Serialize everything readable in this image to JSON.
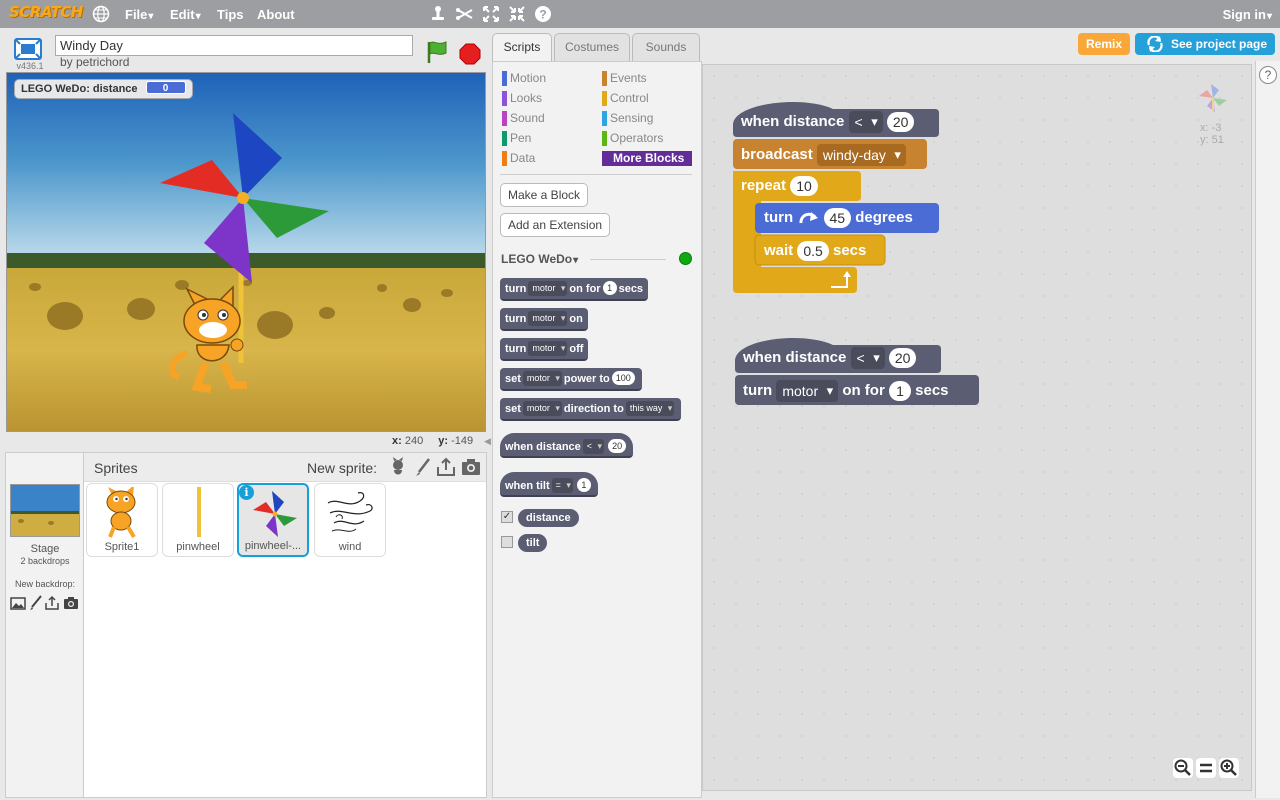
{
  "topbar": {
    "logo": "SCRATCH",
    "menus": {
      "file": "File",
      "edit": "Edit",
      "tips": "Tips",
      "about": "About"
    },
    "signin": "Sign in"
  },
  "project": {
    "title": "Windy Day",
    "byline": "by petrichord",
    "version": "v436.1"
  },
  "stage": {
    "monitor_label": "LEGO WeDo: distance",
    "monitor_value": "0",
    "coords_x_label": "x:",
    "coords_x": "240",
    "coords_y_label": "y:",
    "coords_y": "-149"
  },
  "sprites_pane": {
    "title": "Sprites",
    "new_sprite": "New sprite:",
    "stage_name": "Stage",
    "stage_backdrops": "2 backdrops",
    "new_backdrop": "New backdrop:",
    "sprites": [
      "Sprite1",
      "pinwheel",
      "pinwheel-...",
      "wind"
    ]
  },
  "tabs": {
    "scripts": "Scripts",
    "costumes": "Costumes",
    "sounds": "Sounds"
  },
  "palette": {
    "categories": [
      {
        "label": "Motion",
        "color": "#4a6cd4"
      },
      {
        "label": "Looks",
        "color": "#8a55d7"
      },
      {
        "label": "Sound",
        "color": "#bb42c3"
      },
      {
        "label": "Pen",
        "color": "#0e9a6c"
      },
      {
        "label": "Data",
        "color": "#ee7d16"
      },
      {
        "label": "Events",
        "color": "#c88330"
      },
      {
        "label": "Control",
        "color": "#e1a91a"
      },
      {
        "label": "Sensing",
        "color": "#2ca5e2"
      },
      {
        "label": "Operators",
        "color": "#5cb712"
      },
      {
        "label": "More Blocks",
        "color": "#632d99"
      }
    ],
    "make_block": "Make a Block",
    "add_extension": "Add an Extension",
    "extension_name": "LEGO WeDo",
    "blocks": {
      "turn": "turn",
      "motor": "motor",
      "on_for": "on for",
      "one": "1",
      "secs": "secs",
      "on": "on",
      "off": "off",
      "set": "set",
      "power_to": "power to",
      "hundred": "100",
      "direction_to": "direction to",
      "this_way": "this way",
      "when_distance": "when distance",
      "lt": "<",
      "twenty": "20",
      "when_tilt": "when tilt",
      "eq": "=",
      "distance": "distance",
      "tilt": "tilt"
    }
  },
  "buttons": {
    "remix": "Remix",
    "see_project": "See project page"
  },
  "scripts": {
    "script1": {
      "hat": "when distance",
      "op": "<",
      "value": "20",
      "broadcast": "broadcast",
      "message": "windy-day",
      "repeat": "repeat",
      "repeat_count": "10",
      "turn": "turn",
      "degrees_value": "45",
      "degrees": "degrees",
      "wait": "wait",
      "wait_value": "0.5",
      "secs": "secs"
    },
    "script2": {
      "hat": "when distance",
      "op": "<",
      "value": "20",
      "turn": "turn",
      "motor": "motor",
      "on_for": "on for",
      "secs_value": "1",
      "secs": "secs"
    },
    "sprite_x": "x: -3",
    "sprite_y": "y: 51"
  },
  "help": "?"
}
